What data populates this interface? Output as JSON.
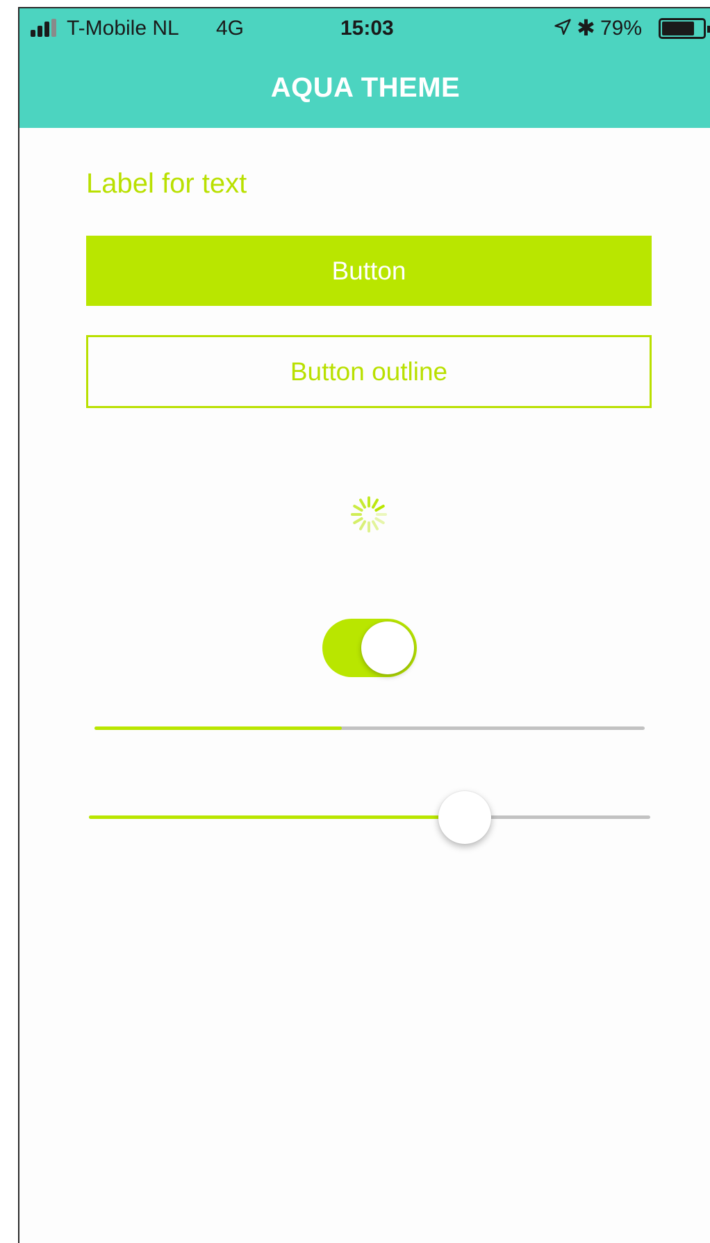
{
  "status_bar": {
    "carrier": "T-Mobile NL",
    "network": "4G",
    "time": "15:03",
    "battery_percent": "79%",
    "battery_level": 0.79,
    "icons": [
      "signal-icon",
      "location-arrow-icon",
      "bluetooth-icon",
      "battery-icon"
    ]
  },
  "header": {
    "title": "AQUA THEME"
  },
  "content": {
    "label_text": "Label for text",
    "primary_button_label": "Button",
    "outline_button_label": "Button outline",
    "switch_on": true,
    "progress_value": 0.45,
    "slider_value": 0.67
  },
  "colors": {
    "header_background": "#4cd4c0",
    "accent": "#b9e600",
    "track": "#c2c2c2",
    "header_text": "#ffffff"
  }
}
